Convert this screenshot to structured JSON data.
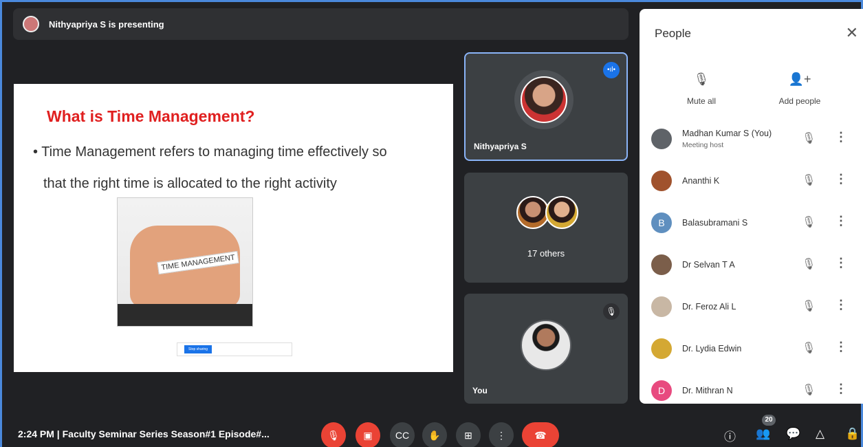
{
  "banner": {
    "text": "Nithyapriya S is presenting"
  },
  "slide": {
    "title": "What is Time Management?",
    "bullet1": "• Time Management refers to managing time effectively so",
    "bullet2": "that the right time is allocated to the right activity",
    "image_text": "TIME MANAGEMENT",
    "stop_button": "Stop sharing"
  },
  "tiles": {
    "presenter_name": "Nithyapriya S",
    "others_label": "17 others",
    "self_label": "You"
  },
  "people": {
    "title": "People",
    "mute_all": "Mute all",
    "add_people": "Add people",
    "list": [
      {
        "name": "Madhan Kumar S (You)",
        "sub": "Meeting host",
        "color": "#5f6368"
      },
      {
        "name": "Ananthi K",
        "sub": "",
        "color": "#a0522d"
      },
      {
        "name": "Balasubramani S",
        "sub": "",
        "color": "#5f8fbf",
        "initial": "B"
      },
      {
        "name": "Dr Selvan T A",
        "sub": "",
        "color": "#7b5e4a"
      },
      {
        "name": "Dr. Feroz Ali L",
        "sub": "",
        "color": "#c8b7a4"
      },
      {
        "name": "Dr. Lydia Edwin",
        "sub": "",
        "color": "#d4a833"
      },
      {
        "name": "Dr. Mithran N",
        "sub": "",
        "color": "#e84a7f",
        "initial": "D"
      }
    ]
  },
  "bottom": {
    "meeting_info": "2:24 PM  |  Faculty Seminar Series Season#1 Episode#...",
    "participants_count": "20"
  },
  "icons": {
    "speaking": "speaking-indicator-icon",
    "mic_off": "mic-off-icon",
    "more": "more-vert-icon"
  }
}
